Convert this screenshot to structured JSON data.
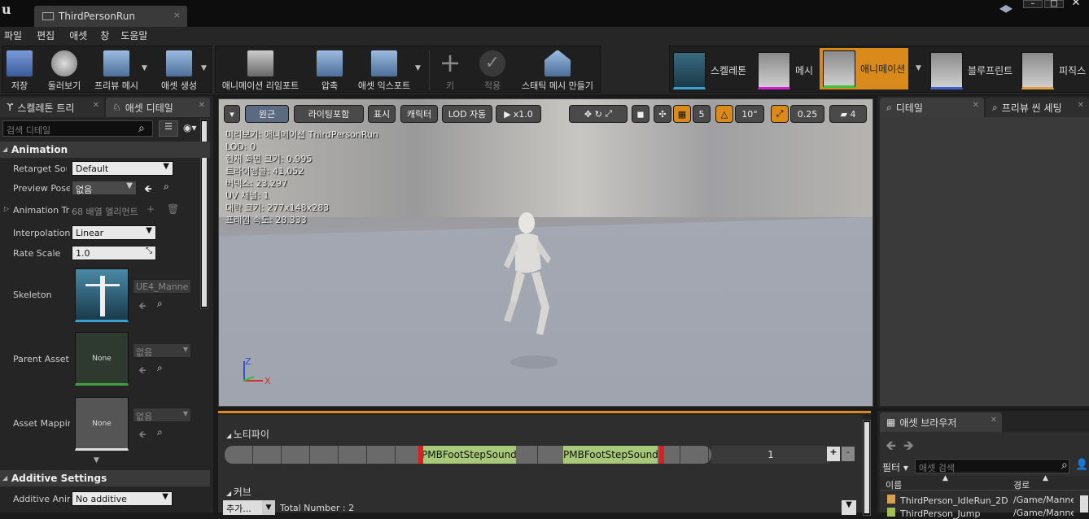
{
  "titlebar": {
    "tab_title": "ThirdPersonRun",
    "close": "×"
  },
  "menu": [
    "파일",
    "편집",
    "애셋",
    "창",
    "도움말"
  ],
  "toolbar": {
    "save": "저장",
    "browse": "둘러보기",
    "preview_mesh": "프리뷰 메시",
    "create_asset": "애셋 생성",
    "retarget": "애니메이션 리임포트",
    "compress": "압축",
    "export": "애셋 익스포트",
    "key": "키",
    "apply": "적용",
    "make_static_mesh": "스태틱 메시 만들기"
  },
  "modes": [
    {
      "label": "스켈레톤",
      "color": "#3aa0d0"
    },
    {
      "label": "메시",
      "color": "#d020d0"
    },
    {
      "label": "애니메이션",
      "color": "#40c040"
    },
    {
      "label": "블루프린트",
      "color": "#4060d0"
    },
    {
      "label": "피직스",
      "color": "#e0a040"
    }
  ],
  "left": {
    "tab_tree": "스켈레톤 트리",
    "tab_details": "애셋 디테일",
    "search_placeholder": "검색 디테일",
    "cat_animation": "Animation",
    "retarget_label": "Retarget Sou",
    "retarget_value": "Default",
    "preview_pose_label": "Preview Pose",
    "preview_pose_value": "없음",
    "anim_track_label": "Animation Tra",
    "anim_track_value": "68 배열 엘리먼트",
    "interp_label": "Interpolation",
    "interp_value": "Linear",
    "rate_label": "Rate Scale",
    "rate_value": "1.0",
    "skeleton_label": "Skeleton",
    "skeleton_value": "UE4_Manne",
    "parent_label": "Parent Asset",
    "parent_thumb": "None",
    "parent_value": "없음",
    "mapping_label": "Asset Mappin",
    "mapping_thumb": "None",
    "mapping_value": "없음",
    "cat_additive": "Additive Settings",
    "additive_label": "Additive Anin",
    "additive_value": "No additive"
  },
  "viewport": {
    "btn_perspective": "원근",
    "btn_lighting": "라이팅포함",
    "btn_show": "표시",
    "btn_character": "캐릭터",
    "btn_lod": "LOD 자동",
    "btn_speed": "x1.0",
    "grid_val": "5",
    "angle_val": "10°",
    "scale_val": "0.25",
    "cam_val": "4",
    "info": [
      "미리보기: 애니메이션 ThirdPersonRun",
      "LOD: 0",
      "현재 화면 크기: 0.995",
      "트라이앵글: 41,052",
      "버텍스: 23,297",
      "UV 채널: 1",
      "대략 크기: 277x148x283",
      "프레임 속도: 28.333"
    ],
    "axis_z": "Z",
    "axis_x": "X"
  },
  "details_panel": {
    "tab_details": "디테일",
    "tab_preview": "프리뷰 씬 세팅"
  },
  "notifies": {
    "header": "노티파이",
    "notify1": "PMBFootStepSound",
    "notify2": "PMBFootStepSound",
    "track_num": "1",
    "curves_header": "커브",
    "add": "추가...",
    "total": "Total Number : 2"
  },
  "asset_browser": {
    "tab": "애셋 브라우저",
    "filter": "필터",
    "search_placeholder": "애셋 검색",
    "col_name": "이름",
    "col_path": "경로",
    "rows": [
      {
        "name": "ThirdPerson_IdleRun_2D",
        "path": "/Game/Manne"
      },
      {
        "name": "ThirdPerson_Jump",
        "path": "/Game/Manne"
      }
    ]
  }
}
